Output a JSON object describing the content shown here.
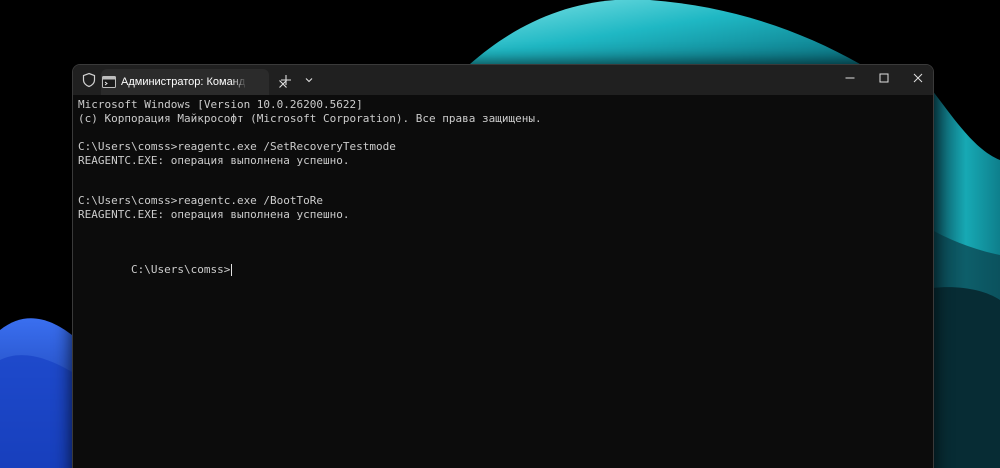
{
  "window": {
    "tab_title": "Администратор: Командная с",
    "new_tab_label": "+",
    "icons": {
      "shield": "shield-icon",
      "terminal": "terminal-icon",
      "close_tab": "close-icon",
      "new_tab": "plus-icon",
      "dropdown": "chevron-down-icon",
      "minimize": "minimize-icon",
      "maximize": "maximize-icon",
      "close_window": "close-icon"
    }
  },
  "terminal": {
    "lines": [
      "Microsoft Windows [Version 10.0.26200.5622]",
      "(c) Корпорация Майкрософт (Microsoft Corporation). Все права защищены.",
      "",
      "C:\\Users\\comss>reagentc.exe /SetRecoveryTestmode",
      "REAGENTC.EXE: операция выполнена успешно.",
      "",
      "",
      "C:\\Users\\comss>reagentc.exe /BootToRe",
      "REAGENTC.EXE: операция выполнена успешно."
    ],
    "prompt": "C:\\Users\\comss>"
  },
  "colors": {
    "terminal_bg": "#0c0c0c",
    "terminal_text": "#cccccc",
    "titlebar_bg": "#202020",
    "active_tab_bg": "#2b2b2b",
    "wallpaper_accent": "#1fb8c4"
  }
}
